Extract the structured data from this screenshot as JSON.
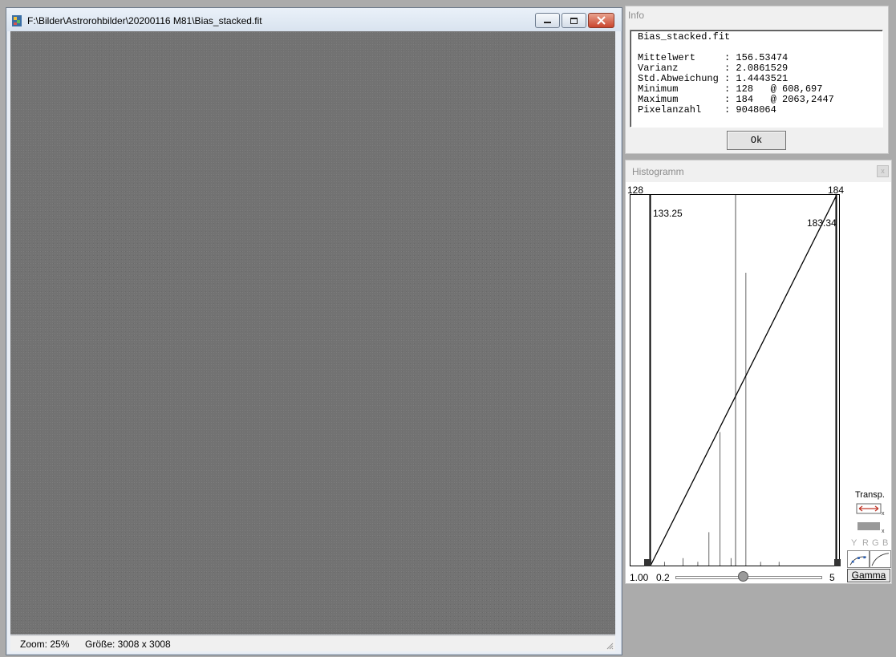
{
  "image_window": {
    "title": "F:\\Bilder\\Astrorohbilder\\20200116 M81\\Bias_stacked.fit",
    "status_zoom": "Zoom: 25%",
    "status_size": "Größe: 3008 x 3008"
  },
  "info": {
    "title": "Info",
    "content": "Bias_stacked.fit\n\nMittelwert     : 156.53474\nVarianz        : 2.0861529\nStd.Abweichung : 1.4443521\nMinimum        : 128   @ 608,697\nMaximum        : 184   @ 2063,2447\nPixelanzahl    : 9048064",
    "ok_label": "Ok"
  },
  "histogram": {
    "title": "Histogramm",
    "close_symbol": "x",
    "range_min": "128",
    "range_max": "184",
    "black_point": "133.25",
    "white_point": "183.34",
    "gamma_value": "1.00",
    "slider_min": "0.2",
    "slider_max": "5",
    "gamma_fraction": 0.46,
    "transp_label": "Transp.",
    "channels": [
      "Y",
      "R",
      "G",
      "B"
    ],
    "gamma_button": "Gamma",
    "histogram_bars": [
      {
        "value": 159,
        "height": 0.79
      },
      {
        "value": 152,
        "height": 0.36
      },
      {
        "value": 149,
        "height": 0.09
      },
      {
        "value": 155,
        "height": 0.02
      },
      {
        "value": 142,
        "height": 0.02
      },
      {
        "value": 137,
        "height": 0.01
      },
      {
        "value": 146,
        "height": 0.01
      },
      {
        "value": 163,
        "height": 0.01
      },
      {
        "value": 168,
        "height": 0.01
      }
    ]
  }
}
